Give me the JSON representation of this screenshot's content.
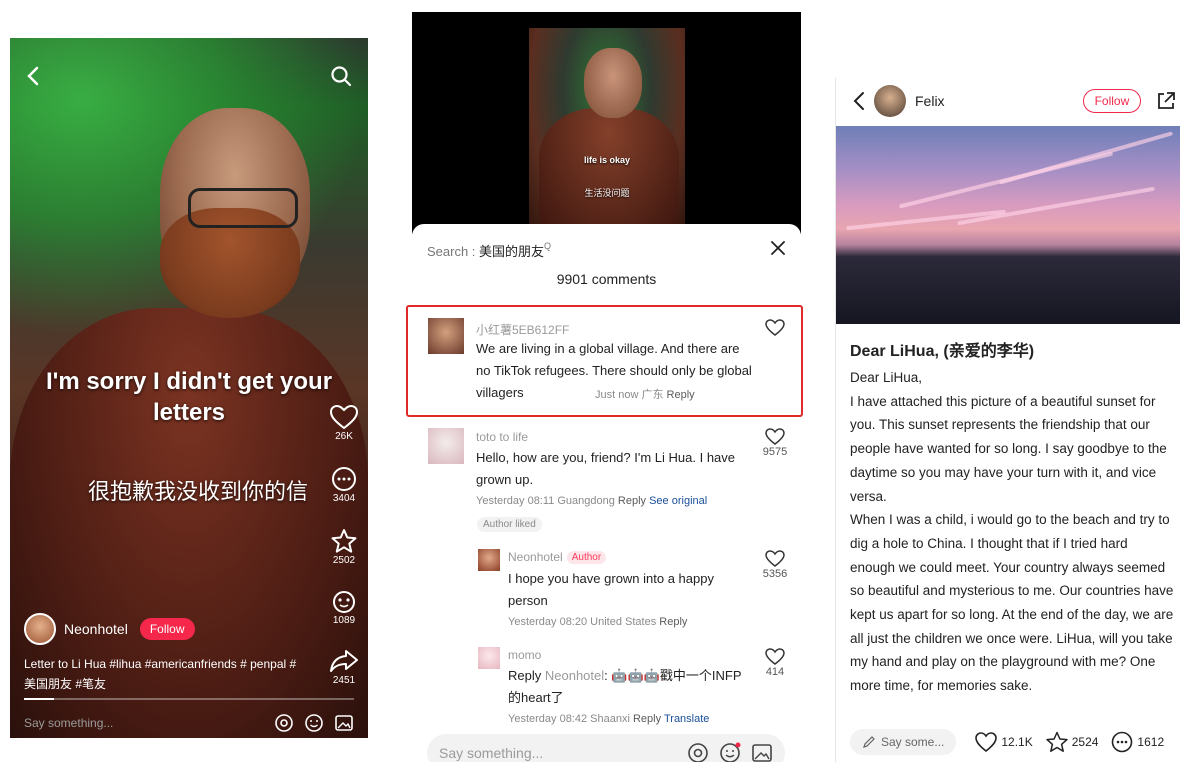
{
  "video": {
    "caption_en": "I'm sorry I didn't get your letters",
    "caption_cn": "很抱歉我没收到你的信",
    "likes": "26K",
    "comments": "3404",
    "favorites": "2502",
    "gifts": "1089",
    "shares": "2451",
    "author": "Neonhotel",
    "follow": "Follow",
    "description": "Letter to Li Hua #lihua  #americanfriends  # penpal  #美国朋友  #笔友",
    "input_placeholder": "Say something...",
    "progress": 0.09
  },
  "comments_panel": {
    "video_caption_en": "life is okay",
    "video_caption_cn": "生活没问题",
    "search_label": "Search : ",
    "search_query": "美国的朋友",
    "count_label": "9901 comments",
    "items": [
      {
        "user": "小红薯5EB612FF",
        "text": "We are living in a global village. And there are no TikTok refugees. There should only be global villagers",
        "time": "Just now 广东",
        "reply": "Reply",
        "likes": ""
      },
      {
        "user": "toto to life",
        "text": "Hello, how are you, friend? I'm Li Hua. I have grown up.",
        "time": "Yesterday 08:11 Guangdong",
        "reply": "Reply",
        "extra_link": "See original",
        "likes": "9575",
        "badge": "Author liked"
      },
      {
        "user": "Neonhotel",
        "tag": "Author",
        "text": "I hope you have grown into a happy person",
        "time": "Yesterday 08:20 United States",
        "reply": "Reply",
        "likes": "5356"
      },
      {
        "user": "momo",
        "text_prefix": "Reply ",
        "text_mention": "Neonhotel",
        "text_rest": ": 🤖🤖🤖戳中一个INFP的heart了",
        "time": "Yesterday 08:42 Shaanxi",
        "reply": "Reply",
        "extra_link": "Translate",
        "likes": "414"
      }
    ],
    "input_placeholder": "Say something..."
  },
  "post": {
    "author": "Felix",
    "follow": "Follow",
    "title": "Dear LiHua, (亲爱的李华)",
    "body": [
      "Dear LiHua,",
      "I have attached this picture of a beautiful sunset for you. This sunset represents the friendship that our people have wanted for so long. I say goodbye to the daytime so you may have your turn with it, and vice versa.",
      "When I was a child, i would go to the beach and try to dig a hole to China. I thought that if I tried hard enough we could meet. Your country always seemed so beautiful and mysterious to me. Our countries have kept us apart for so long. At the end of the day, we are all just the children we once were. LiHua, will you take my hand and play on the playground with me? One more time, for memories sake."
    ],
    "say_placeholder": "Say some...",
    "likes": "12.1K",
    "favorites": "2524",
    "comments": "1612"
  }
}
